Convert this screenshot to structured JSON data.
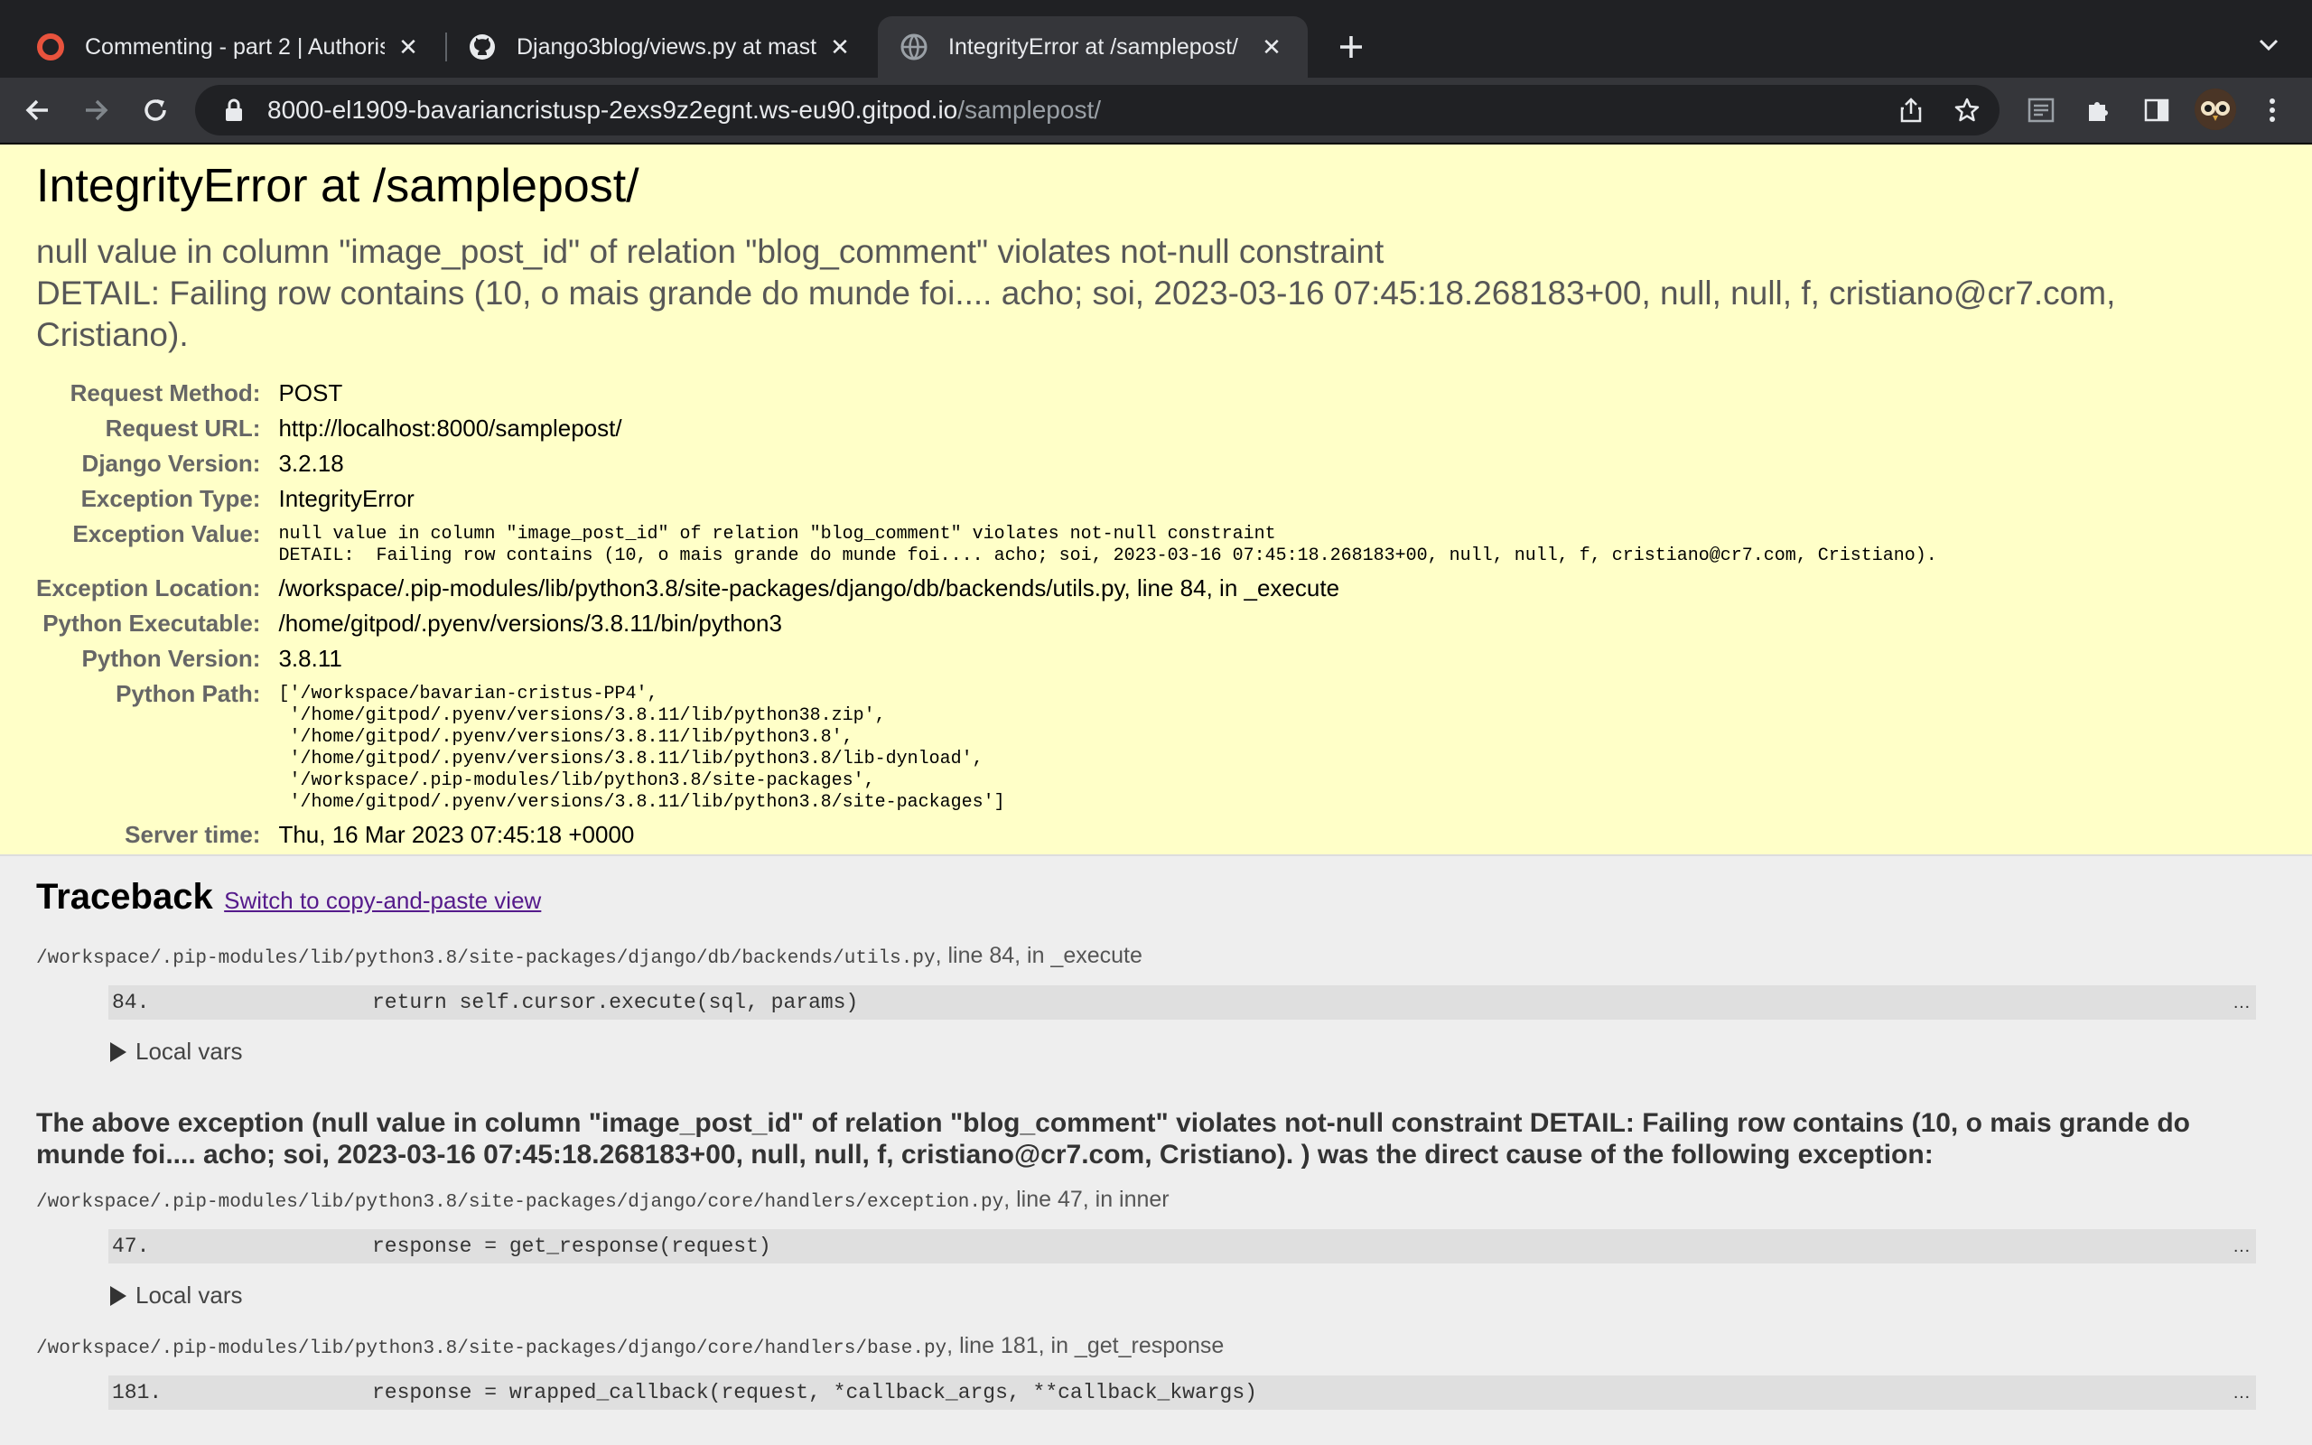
{
  "browser": {
    "tabs": [
      {
        "title": "Commenting - part 2 | Authoris",
        "icon": "circle-logo-icon"
      },
      {
        "title": "Django3blog/views.py at maste",
        "icon": "github-icon"
      },
      {
        "title": "IntegrityError at /samplepost/",
        "icon": "globe-icon",
        "active": true
      }
    ],
    "address": {
      "host": "8000-el1909-bavariancristusp-2exs9z2egnt.ws-eu90.gitpod.io",
      "path": "/samplepost/"
    }
  },
  "error": {
    "title": "IntegrityError at /samplepost/",
    "message_line1": "null value in column \"image_post_id\" of relation \"blog_comment\" violates not-null constraint",
    "message_line2": "DETAIL:  Failing row contains (10, o mais grande do munde foi.... acho; soi, 2023-03-16 07:45:18.268183+00, null, null, f, cristiano@cr7.com, Cristiano).",
    "meta": {
      "request_method_label": "Request Method:",
      "request_method": "POST",
      "request_url_label": "Request URL:",
      "request_url": "http://localhost:8000/samplepost/",
      "django_version_label": "Django Version:",
      "django_version": "3.2.18",
      "exception_type_label": "Exception Type:",
      "exception_type": "IntegrityError",
      "exception_value_label": "Exception Value:",
      "exception_value": "null value in column \"image_post_id\" of relation \"blog_comment\" violates not-null constraint\nDETAIL:  Failing row contains (10, o mais grande do munde foi.... acho; soi, 2023-03-16 07:45:18.268183+00, null, null, f, cristiano@cr7.com, Cristiano).",
      "exception_location_label": "Exception Location:",
      "exception_location": "/workspace/.pip-modules/lib/python3.8/site-packages/django/db/backends/utils.py, line 84, in _execute",
      "python_executable_label": "Python Executable:",
      "python_executable": "/home/gitpod/.pyenv/versions/3.8.11/bin/python3",
      "python_version_label": "Python Version:",
      "python_version": "3.8.11",
      "python_path_label": "Python Path:",
      "python_path": "['/workspace/bavarian-cristus-PP4',\n '/home/gitpod/.pyenv/versions/3.8.11/lib/python38.zip',\n '/home/gitpod/.pyenv/versions/3.8.11/lib/python3.8',\n '/home/gitpod/.pyenv/versions/3.8.11/lib/python3.8/lib-dynload',\n '/workspace/.pip-modules/lib/python3.8/site-packages',\n '/home/gitpod/.pyenv/versions/3.8.11/lib/python3.8/site-packages']",
      "server_time_label": "Server time:",
      "server_time": "Thu, 16 Mar 2023 07:45:18 +0000"
    }
  },
  "traceback": {
    "heading": "Traceback",
    "switch_link": "Switch to copy-and-paste view",
    "local_vars_label": "Local vars",
    "ellipsis": "…",
    "frames": [
      {
        "file": "/workspace/.pip-modules/lib/python3.8/site-packages/django/db/backends/utils.py",
        "suffix": ", line 84, in _execute",
        "lineno": "84.",
        "code": "return self.cursor.execute(sql, params)"
      },
      {
        "file": "/workspace/.pip-modules/lib/python3.8/site-packages/django/core/handlers/exception.py",
        "suffix": ", line 47, in inner",
        "lineno": "47.",
        "code": "response = get_response(request)"
      },
      {
        "file": "/workspace/.pip-modules/lib/python3.8/site-packages/django/core/handlers/base.py",
        "suffix": ", line 181, in _get_response",
        "lineno": "181.",
        "code": " response = wrapped_callback(request, *callback_args, **callback_kwargs)"
      }
    ],
    "cause_text": "The above exception (null value in column \"image_post_id\" of relation \"blog_comment\" violates not-null constraint DETAIL: Failing row contains (10, o mais grande do munde foi.... acho; soi, 2023-03-16 07:45:18.268183+00, null, null, f, cristiano@cr7.com, Cristiano). ) was the direct cause of the following exception:"
  },
  "colors": {
    "summary_bg": "#ffffc8",
    "page_bg": "#eeeeee",
    "chrome_dark": "#202124",
    "chrome_toolbar": "#35363a"
  }
}
